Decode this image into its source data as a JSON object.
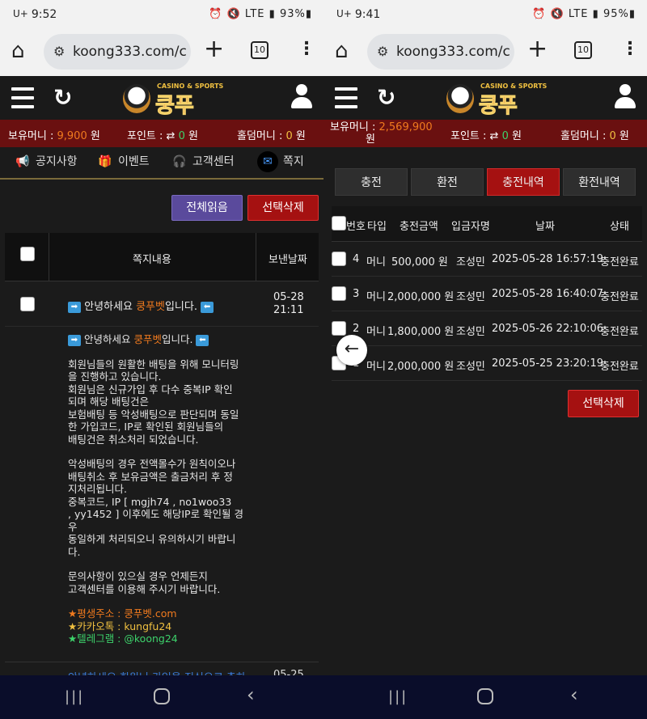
{
  "left": {
    "status": {
      "carrier": "U+",
      "time": "9:52",
      "icons": "⏰ 🔇 LTE ▮",
      "battery": "93%▮"
    },
    "browser": {
      "url": "koong333.com/cu",
      "tab_count": "10"
    },
    "site": {
      "logo_sub": "CASINO & SPORTS",
      "logo_main": "쿵푸"
    },
    "balance": {
      "money_label": "보유머니 : ",
      "money_value": "9,900",
      "money_unit": " 원",
      "point_label": "포인트 : ",
      "point_icon": "⇄",
      "point_value": "0",
      "point_unit": " 원",
      "hold_label": "홀덤머니 : ",
      "hold_value": "0",
      "hold_unit": " 원"
    },
    "nav": [
      {
        "label": "공지사항",
        "icon": "megaphone-icon"
      },
      {
        "label": "이벤트",
        "icon": "gift-icon"
      },
      {
        "label": "고객센터",
        "icon": "headset-icon"
      },
      {
        "label": "쪽지",
        "icon": "mail-icon"
      }
    ],
    "buttons": {
      "read_all": "전체읽음",
      "delete_selected": "선택삭제"
    },
    "table": {
      "col_content": "쪽지내용",
      "col_date": "보낸날짜"
    },
    "message": {
      "title_pre": "안녕하세요 ",
      "title_brand": "쿵푸벳",
      "title_post": "입니다.",
      "date": "05-28",
      "time": "21:11"
    },
    "body": {
      "title_pre": "안녕하세요 ",
      "title_brand": "쿵푸벳",
      "title_post": "입니다.",
      "lines1": [
        "회원님들의 원활한 배팅을 위해 모니터링",
        "을 진행하고 있습니다.",
        "회원님은 신규가입 후 다수 중복IP 확인",
        "되며 해당 배팅건은",
        "보험배팅 등 악성배팅으로 판단되며 동일",
        "한 가입코드, IP로 확인된 회원님들의",
        "배팅건은 취소처리 되었습니다."
      ],
      "lines2": [
        "악성배팅의 경우 전액몰수가 원칙이오나",
        "배팅취소 후 보유금액은 출금처리 후 정",
        "지처리됩니다.",
        "중복코드, IP  [ mgjh74 , no1woo33",
        ", yy1452 ] 이후에도 해당IP로 확인될 경",
        "우",
        "동일하게 처리되오니 유의하시기 바랍니",
        "다."
      ],
      "lines3": [
        "문의사항이 있으실 경우 언제든지",
        "고객센터를 이용해 주시기 바랍니다."
      ],
      "addr_label": "★평생주소 : ",
      "addr_value": "쿵푸벳.com",
      "kakao_label": "★카카오톡 : ",
      "kakao_value": "kungfu24",
      "tele_label": "★텔레그램 : ",
      "tele_value": "@koong24"
    },
    "next_row": {
      "text": "안녕하세요 회원님 가입을 진심으로 축하",
      "date": "05-25"
    }
  },
  "right": {
    "status": {
      "carrier": "U+",
      "time": "9:41",
      "icons": "⏰ 🔇 LTE ▮",
      "battery": "95%▮"
    },
    "browser": {
      "url": "koong333.com/cu",
      "tab_count": "10"
    },
    "site": {
      "logo_sub": "CASINO & SPORTS",
      "logo_main": "쿵푸"
    },
    "balance": {
      "money_label": "보유머니 : ",
      "money_value": "2,569,900",
      "money_unit": "원",
      "point_label": "포인트 : ",
      "point_icon": "⇄",
      "point_value": "0",
      "point_unit": " 원",
      "hold_label": "홀덤머니 : ",
      "hold_value": "0",
      "hold_unit": " 원"
    },
    "tabs": [
      "충전",
      "환전",
      "충전내역",
      "환전내역"
    ],
    "table": {
      "headers": [
        "번호",
        "타입",
        "충전금액",
        "입금자명",
        "날짜",
        "상태"
      ],
      "rows": [
        {
          "no": "4",
          "type": "머니",
          "amount": "500,000 원",
          "name": "조성민",
          "date": "2025-05-28 16:57:19",
          "status": "충전완료"
        },
        {
          "no": "3",
          "type": "머니",
          "amount": "2,000,000 원",
          "name": "조성민",
          "date": "2025-05-28 16:40:07",
          "status": "충전완료"
        },
        {
          "no": "2",
          "type": "머니",
          "amount": "1,800,000 원",
          "name": "조성민",
          "date": "2025-05-26 22:10:06",
          "status": "충전완료"
        },
        {
          "no": "1",
          "type": "머니",
          "amount": "2,000,000 원",
          "name": "조성민",
          "date": "2025-05-25 23:20:19",
          "status": "충전완료"
        }
      ]
    },
    "buttons": {
      "delete_selected": "선택삭제"
    }
  }
}
